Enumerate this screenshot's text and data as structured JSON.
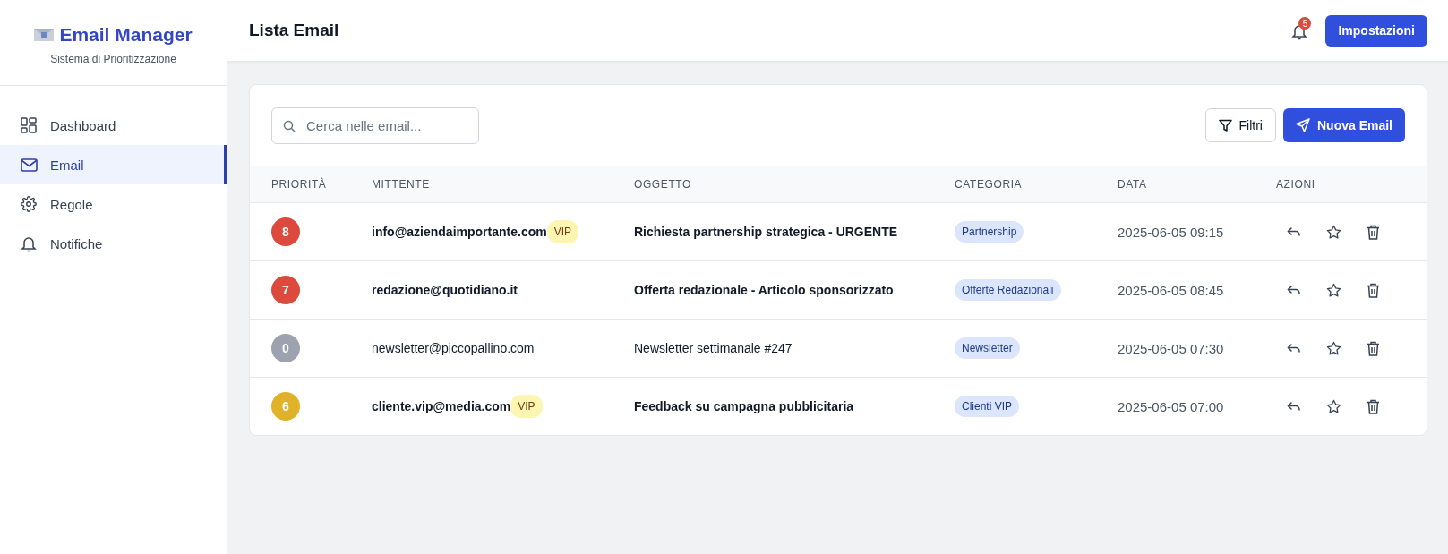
{
  "sidebar": {
    "logo_title": "Email Manager",
    "logo_subtitle": "Sistema di Prioritizzazione",
    "items": [
      {
        "label": "Dashboard",
        "kind": "dashboard",
        "selected": false
      },
      {
        "label": "Email",
        "kind": "email",
        "selected": true
      },
      {
        "label": "Regole",
        "kind": "rules",
        "selected": false
      },
      {
        "label": "Notifiche",
        "kind": "notifications",
        "selected": false
      }
    ]
  },
  "header": {
    "title": "Lista Email",
    "notification_count": "5",
    "settings_button": "Impostazioni"
  },
  "toolbar": {
    "search": {
      "placeholder": "Cerca nelle email..."
    },
    "filter_button": "Filtri",
    "new_button": "Nuova Email"
  },
  "table": {
    "columns": [
      "PRIORITÀ",
      "MITTENTE",
      "OGGETTO",
      "CATEGORIA",
      "DATA",
      "AZIONI"
    ],
    "rows": [
      {
        "priority": "8",
        "color": "#dc4a3d",
        "sender": "info@aziendaimportante.com",
        "vip": "VIP",
        "subject": "Richiesta partnership strategica - URGENTE",
        "category": "Partnership",
        "date": "2025-06-05 09:15",
        "unread": true
      },
      {
        "priority": "7",
        "color": "#dc4a3d",
        "sender": "redazione@quotidiano.it",
        "subject": "Offerta redazionale - Articolo sponsorizzato",
        "category": "Offerte Redazionali",
        "date": "2025-06-05 08:45",
        "unread": true
      },
      {
        "priority": "0",
        "color": "#9ca3af",
        "sender": "newsletter@piccopallino.com",
        "subject": "Newsletter settimanale #247",
        "category": "Newsletter",
        "date": "2025-06-05 07:30",
        "unread": false
      },
      {
        "priority": "6",
        "color": "#e0b22a",
        "sender": "cliente.vip@media.com",
        "vip": "VIP",
        "subject": "Feedback su campagna pubblicitaria",
        "category": "Clienti VIP",
        "date": "2025-06-05 07:00",
        "unread": true
      }
    ]
  }
}
